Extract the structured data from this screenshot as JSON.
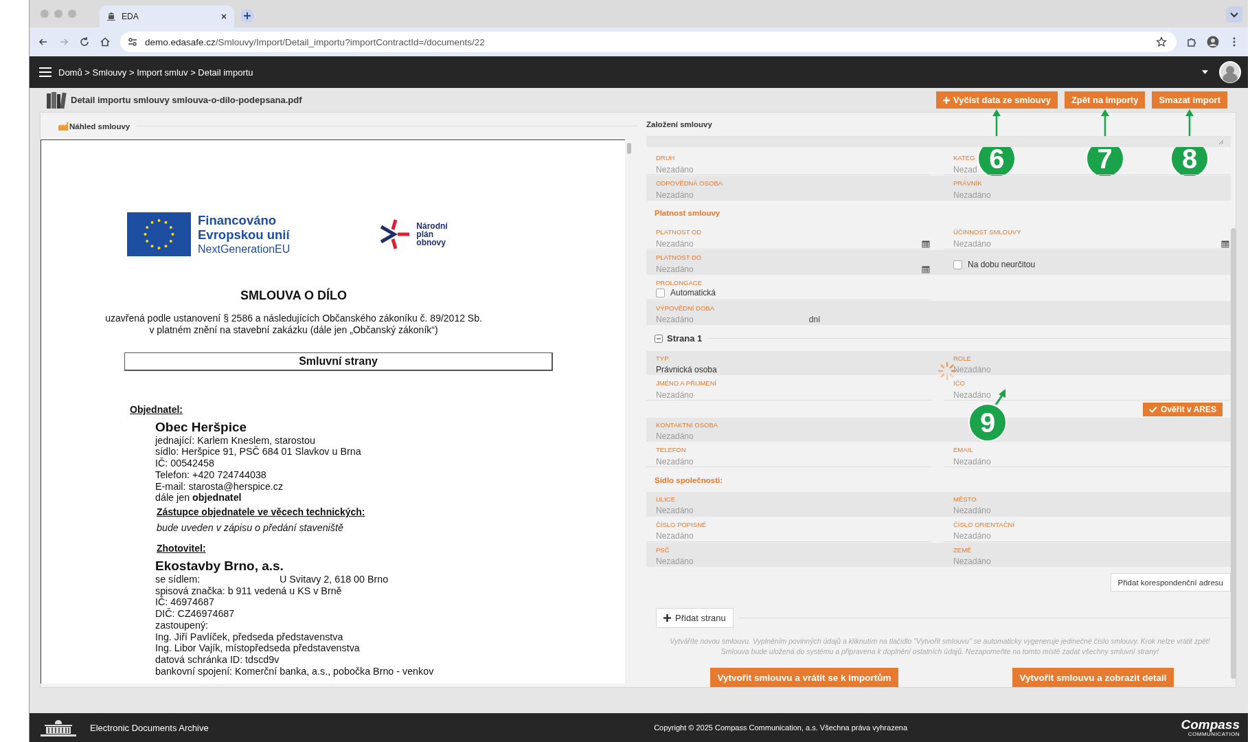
{
  "browser": {
    "tab_title": "EDA",
    "url_host": "demo.edasafe.cz",
    "url_path": "/Smlouvy/Import/Detail_importu?importContractId=/documents/22"
  },
  "header": {
    "breadcrumb": "Domů > Smlouvy > Import smluv > Detail importu"
  },
  "page_title": "Detail importu smlouvy smlouva-o-dilo-podepsana.pdf",
  "actions": [
    {
      "label": "Vyčíst data ze smlouvy",
      "kind": "add",
      "callout": "6"
    },
    {
      "label": "Zpět na importy",
      "kind": "plain",
      "callout": "7"
    },
    {
      "label": "Smazat import",
      "kind": "plain",
      "callout": "8"
    }
  ],
  "preview": {
    "title": "Náhled smlouvy",
    "eu_logo": [
      "Financováno",
      "Evropskou unií",
      "NextGenerationEU"
    ],
    "npo_logo": [
      "Národní",
      "plán",
      "obnovy"
    ],
    "doc_title": "SMLOUVA O DÍLO",
    "intro": [
      "uzavřená podle ustanovení § 2586 a následujících Občanského zákoníku č. 89/2012 Sb.",
      "v platném znění na stavební zakázku (dále jen „Občanský zákoník“)"
    ],
    "section_box": "Smluvní strany",
    "lines": [
      {
        "kind": "heading",
        "text": "Objednatel:"
      },
      {
        "kind": "name",
        "text": "Obec Heršpice"
      },
      {
        "kind": "line",
        "text": "jednající: Karlem Kneslem, starostou"
      },
      {
        "kind": "line",
        "text": "sídlo: Heršpice 91, PSČ 684 01 Slavkov u Brna"
      },
      {
        "kind": "line",
        "text": "IČ: 00542458"
      },
      {
        "kind": "line",
        "text": "Telefon: +420 724744038"
      },
      {
        "kind": "line",
        "text": "E-mail: starosta@herspice.cz"
      },
      {
        "kind": "line",
        "text": "dále jen **objednatel**"
      },
      {
        "kind": "subheading",
        "text": "Zástupce objednatele ve věcech technických:"
      },
      {
        "kind": "italic",
        "text": "bude uveden v zápisu o předání staveniště"
      },
      {
        "kind": "subheading",
        "text": "Zhotovitel:"
      },
      {
        "kind": "name",
        "text": "Ekostavby Brno, a.s."
      },
      {
        "kind": "pair",
        "label": "se sídlem:",
        "text": "U Svitavy 2, 618 00 Brno"
      },
      {
        "kind": "line",
        "text": "spisová značka: b 911 vedená u KS v Brně"
      },
      {
        "kind": "line",
        "text": "IČ:  46974687"
      },
      {
        "kind": "line",
        "text": "DIČ:  CZ46974687"
      },
      {
        "kind": "line",
        "text": "zastoupený:"
      },
      {
        "kind": "line",
        "text": "Ing. Jiří Pavlíček, předseda představenstva"
      },
      {
        "kind": "line",
        "text": "Ing. Libor Vajík, místopředseda představenstva"
      },
      {
        "kind": "line",
        "text": "datová schránka ID: tdscd9v"
      },
      {
        "kind": "line",
        "text": "bankovní spojení: Komerční banka, a.s., pobočka Brno - venkov"
      }
    ]
  },
  "form": {
    "title": "Založení smlouvy",
    "items": [
      {
        "kind": "row",
        "shaded": false,
        "cells": [
          {
            "kind": "text",
            "label": "DRUH",
            "placeholder": "Nezadáno"
          },
          {
            "kind": "text",
            "label": "KATEG",
            "placeholder": "Nezad"
          }
        ]
      },
      {
        "kind": "row",
        "shaded": true,
        "cells": [
          {
            "kind": "text",
            "label": "ODPOVĚDNÁ OSOBA",
            "placeholder": "Nezadáno"
          },
          {
            "kind": "text",
            "label": "PRÁVNÍK",
            "placeholder": "Nezadáno"
          }
        ]
      },
      {
        "kind": "section",
        "text": "Platnost smlouvy"
      },
      {
        "kind": "row",
        "shaded": false,
        "cells": [
          {
            "kind": "date",
            "label": "PLATNOST OD",
            "placeholder": "Nezadáno"
          },
          {
            "kind": "date",
            "label": "ÚČINNOST SMLOUVY",
            "placeholder": "Nezadáno"
          }
        ]
      },
      {
        "kind": "row",
        "shaded": true,
        "cells": [
          {
            "kind": "date",
            "label": "PLATNOST DO",
            "placeholder": "Nezadáno"
          },
          {
            "kind": "check",
            "option": "Na dobu neurčitou",
            "checked": false
          }
        ]
      },
      {
        "kind": "row",
        "shaded": false,
        "cells": [
          {
            "kind": "check",
            "label": "PROLONGACE",
            "option": "Automatická",
            "checked": false
          }
        ]
      },
      {
        "kind": "row",
        "shaded": true,
        "cells": [
          {
            "kind": "days",
            "label": "VÝPOVĚDNÍ DOBA",
            "placeholder": "Nezadáno",
            "unit": "dní"
          }
        ]
      },
      {
        "kind": "group",
        "title": "Strana 1",
        "expanded": true
      },
      {
        "kind": "row",
        "shaded": true,
        "cells": [
          {
            "kind": "text",
            "label": "TYP",
            "value": "Právnická osoba"
          },
          {
            "kind": "text",
            "label": "ROLE",
            "placeholder": "Nezadáno",
            "loading": true
          }
        ]
      },
      {
        "kind": "row",
        "shaded": false,
        "cells": [
          {
            "kind": "text",
            "label": "JMÉNO A PŘIJMENÍ",
            "placeholder": "Nezadáno"
          },
          {
            "kind": "text",
            "label": "IČO",
            "placeholder": "Nezadáno",
            "callout": "9"
          }
        ]
      },
      {
        "kind": "verify",
        "label": "Ověřit v ARES"
      },
      {
        "kind": "row",
        "shaded": true,
        "cells": [
          {
            "kind": "text",
            "label": "KONTAKTNÍ OSOBA",
            "placeholder": "Nezadáno"
          }
        ]
      },
      {
        "kind": "row",
        "shaded": false,
        "cells": [
          {
            "kind": "text",
            "label": "TELEFON",
            "placeholder": "Nezadáno"
          },
          {
            "kind": "text",
            "label": "EMAIL",
            "placeholder": "Nezadáno"
          }
        ]
      },
      {
        "kind": "section",
        "text": "Sídlo společnosti:"
      },
      {
        "kind": "row",
        "shaded": true,
        "cells": [
          {
            "kind": "text",
            "label": "ULICE",
            "placeholder": "Nezadáno"
          },
          {
            "kind": "text",
            "label": "MĚSTO",
            "placeholder": "Nezadáno"
          }
        ]
      },
      {
        "kind": "row",
        "shaded": false,
        "cells": [
          {
            "kind": "text",
            "label": "ČÍSLO POPISNÉ",
            "placeholder": "Nezadáno"
          },
          {
            "kind": "text",
            "label": "ČÍSLO ORIENTAČNÍ",
            "placeholder": "Nezadáno"
          }
        ]
      },
      {
        "kind": "row",
        "shaded": true,
        "cells": [
          {
            "kind": "text",
            "label": "PSČ",
            "placeholder": "Nezadáno"
          },
          {
            "kind": "text",
            "label": "ZEMĚ",
            "placeholder": "Nezadáno"
          }
        ]
      },
      {
        "kind": "add-address",
        "label": "Přidat korespondenční adresu"
      },
      {
        "kind": "add-party",
        "label": "Přidat stranu"
      },
      {
        "kind": "note",
        "text": "Vytváříte novou smlouvu. Vyplněním povinných údajů a kliknutím na tlačidlo \"Vytvořit smlouvu\" se automaticky vygeneruje jedinečné číslo smlouvy. Krok nelze vrátit zpět! Smlouva bude uložená do systému a připravena k doplnění ostatních údajů. Nezapomeňte na tomto místě zadat všechny smluvní strany!"
      }
    ],
    "submit": [
      "Vytvořit smlouvu a vrátit se k importům",
      "Vytvořit smlouvu a zobrazit detail"
    ]
  },
  "footer": {
    "app_name": "Electronic Documents Archive",
    "copyright": "Copyright © 2025 Compass Communication, a.s. Všechna práva vyhrazena",
    "brand": "Compass",
    "brand_sub": "COMMUNICATION"
  }
}
